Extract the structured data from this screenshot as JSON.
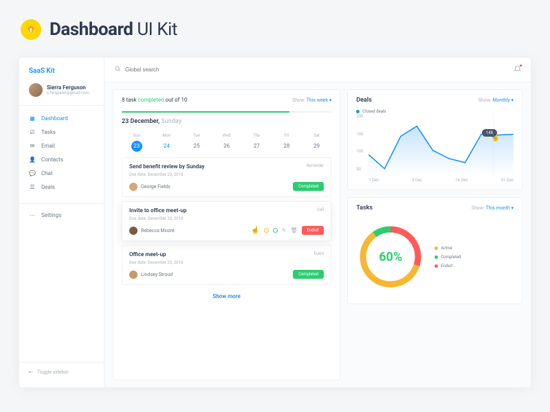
{
  "page": {
    "title_bold": "Dashboard",
    "title_rest": " UI Kit"
  },
  "sidebar": {
    "brand": "SaaS Kit",
    "user": {
      "name": "Sierra Ferguson",
      "email": "s.ferguson@gmail.com"
    },
    "items": [
      {
        "label": "Dashboard",
        "icon": "grid",
        "active": true
      },
      {
        "label": "Tasks",
        "icon": "check"
      },
      {
        "label": "Email",
        "icon": "mail"
      },
      {
        "label": "Contacts",
        "icon": "user"
      },
      {
        "label": "Chat",
        "icon": "chat"
      },
      {
        "label": "Deals",
        "icon": "stack"
      }
    ],
    "settings_label": "Settings",
    "toggle_label": "Toggle sidebar"
  },
  "topbar": {
    "search_placeholder": "Global search"
  },
  "tasks_card": {
    "progress": {
      "completed": 8,
      "total": 10,
      "prefix": "8 task ",
      "mid": "completed",
      "suffix": " out of 10"
    },
    "show_label": "Show:",
    "show_value": "This week",
    "date_main": "23 December,",
    "date_sub": " Sunday",
    "days": [
      {
        "dow": "Sun",
        "num": "23",
        "selected": true
      },
      {
        "dow": "Mon",
        "num": "24",
        "blue": true
      },
      {
        "dow": "Tue",
        "num": "25"
      },
      {
        "dow": "Wed",
        "num": "26"
      },
      {
        "dow": "Thu",
        "num": "27"
      },
      {
        "dow": "Fri",
        "num": "28"
      },
      {
        "dow": "Sat",
        "num": "29"
      }
    ],
    "items": [
      {
        "title": "Send benefit review by Sunday",
        "tag": "Reminder",
        "due_label": "Due date:",
        "due_date": "December 23, 2018",
        "assignee": "George Fields",
        "avatar_color": "#d6a77a",
        "status": "Completed",
        "status_color": "green"
      },
      {
        "title": "Invite to office meet-up",
        "tag": "Call",
        "due_label": "Due date:",
        "due_date": "December 23, 2018",
        "assignee": "Rebecca Moore",
        "avatar_color": "#7a5c3e",
        "status": "Ended",
        "status_color": "red",
        "elevated": true,
        "actions": true
      },
      {
        "title": "Office meet-up",
        "tag": "Event",
        "due_label": "Due date:",
        "due_date": "December 23, 2018",
        "assignee": "Lindsey Stroud",
        "avatar_color": "#c49a6c",
        "status": "Completed",
        "status_color": "green"
      }
    ],
    "show_more": "Show more"
  },
  "deals_card": {
    "title": "Deals",
    "show_label": "Show:",
    "show_value": "Monthly",
    "legend": "Closed deals",
    "tooltip_value": "148"
  },
  "chart_data": {
    "type": "line",
    "title": "Deals",
    "series": [
      {
        "name": "Closed deals",
        "values": [
          100,
          65,
          145,
          170,
          110,
          90,
          80,
          150,
          148,
          150
        ]
      }
    ],
    "x": [
      "1 Dec",
      "",
      "8 Dec",
      "",
      "",
      "16 Dec",
      "",
      "",
      "",
      "31 Dec"
    ],
    "x_ticks": [
      "1 Dec",
      "8 Dec",
      "16 Dec",
      "31 Dec"
    ],
    "y_ticks": [
      50,
      100,
      150,
      200
    ],
    "ylim": [
      50,
      200
    ],
    "xlabel": "",
    "ylabel": ""
  },
  "tasks_donut": {
    "title": "Tasks",
    "show_label": "Show:",
    "show_value": "This month",
    "center": "60%",
    "legend": [
      {
        "label": "Active",
        "color": "yellow"
      },
      {
        "label": "Completed",
        "color": "green"
      },
      {
        "label": "Ended",
        "color": "red"
      }
    ],
    "data": {
      "active": 60,
      "completed": 10,
      "ended": 30
    }
  }
}
